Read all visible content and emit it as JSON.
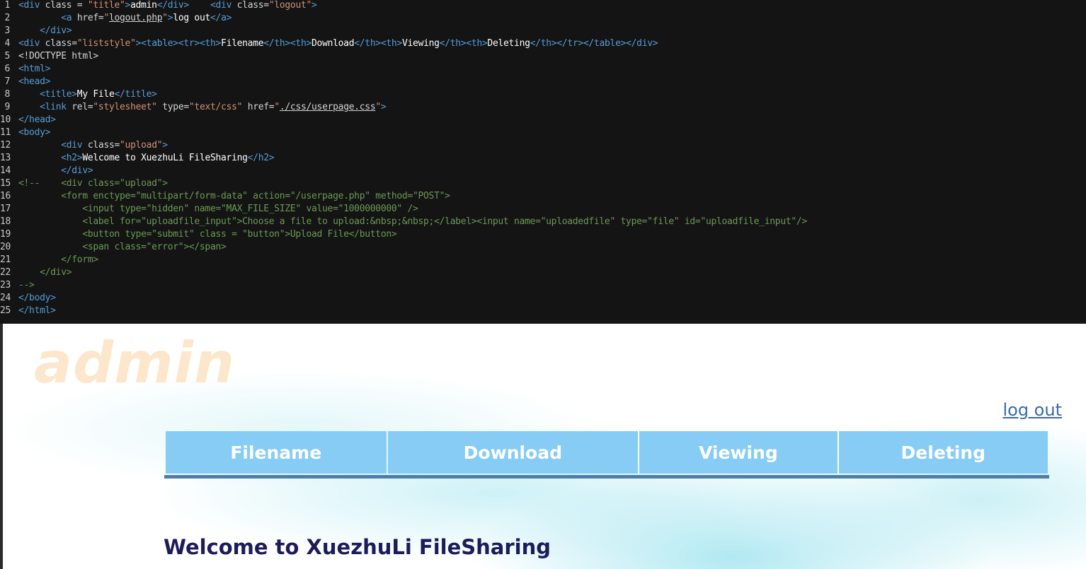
{
  "editor": {
    "lines": [
      {
        "n": "1"
      },
      {
        "n": "2"
      },
      {
        "n": "3"
      },
      {
        "n": "4"
      },
      {
        "n": "5"
      },
      {
        "n": "6"
      },
      {
        "n": "7"
      },
      {
        "n": "8"
      },
      {
        "n": "9"
      },
      {
        "n": "10"
      },
      {
        "n": "11"
      },
      {
        "n": "12"
      },
      {
        "n": "13"
      },
      {
        "n": "14"
      },
      {
        "n": "15"
      },
      {
        "n": "16"
      },
      {
        "n": "17"
      },
      {
        "n": "18"
      },
      {
        "n": "19"
      },
      {
        "n": "20"
      },
      {
        "n": "21"
      },
      {
        "n": "22"
      },
      {
        "n": "23"
      },
      {
        "n": "24"
      },
      {
        "n": "25"
      }
    ],
    "colors": {
      "background": "#141414",
      "tag": "#569cd6",
      "string": "#ce9178",
      "comment": "#6a9955"
    }
  },
  "page": {
    "title_text": "admin",
    "logout_label": "log out",
    "table_headers": [
      "Filename",
      "Download",
      "Viewing",
      "Deleting"
    ],
    "welcome_heading": "Welcome to XuezhuLi FileSharing",
    "colors": {
      "header_bg": "#87ccf5",
      "header_text": "#ffffff",
      "title": "#fde7cc",
      "link": "#3a6aa8",
      "heading": "#1c1c5c",
      "table_rule": "#4d7ea8"
    }
  }
}
